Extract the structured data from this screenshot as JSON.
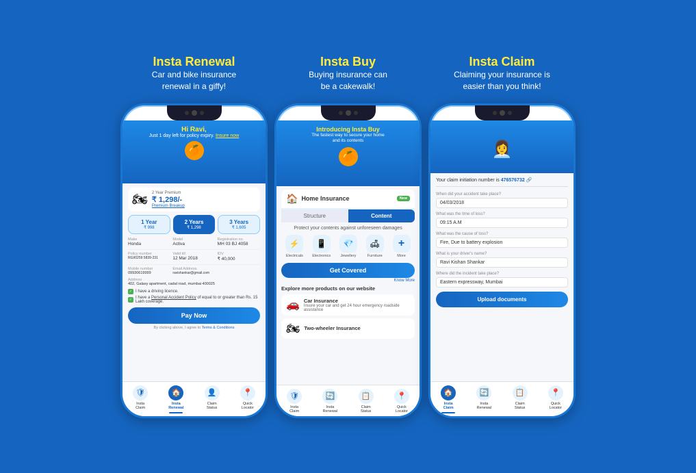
{
  "background_color": "#1565C0",
  "sections": [
    {
      "id": "insta_renewal",
      "title": "Insta Renewal",
      "subtitle": "Car and bike insurance\nrenewal in a giffy!",
      "screen": {
        "greeting": "Hi Ravi,",
        "greeting_sub": "Just 1 day left for policy expiry",
        "greeting_link": "Insure now",
        "premium_label": "2 Year Premium",
        "premium_amount": "₹ 1,298/-",
        "premium_link": "Premium Breakup",
        "year_tabs": [
          {
            "label": "1 Year",
            "price": "₹ 998",
            "active": false
          },
          {
            "label": "2 Years",
            "price": "₹ 1,298",
            "active": true
          },
          {
            "label": "3 Years",
            "price": "₹ 1,605",
            "active": false
          }
        ],
        "details": [
          {
            "label": "Make",
            "value": "Honda"
          },
          {
            "label": "Model",
            "value": "Activa"
          },
          {
            "label": "Registration no.",
            "value": "MH 03 BJ 4058"
          }
        ],
        "details2": [
          {
            "label": "Policy number",
            "value": "RGI/0259 5839-231"
          },
          {
            "label": "Valid till",
            "value": "12 Mar 2018"
          },
          {
            "label": "IDV",
            "value": "₹ 40,000"
          }
        ],
        "details3": [
          {
            "label": "Mobile number",
            "value": "09930619999"
          },
          {
            "label": "Email Address",
            "value": "ravishankar@gmail.com"
          }
        ],
        "address_label": "Address",
        "address_value": "402, Galaxy apartment, cadal road, mumbai 400025",
        "checkboxes": [
          {
            "text": "I have a driving licence.",
            "checked": true
          },
          {
            "text": "I have a Personal Accident Policy of equal to or greater than Rs. 15 Lakh coverage.",
            "checked": true
          }
        ],
        "pay_button": "Pay Now",
        "terms_text": "By clicking above, I agree to Terms & Conditions",
        "nav_items": [
          {
            "label": "Insta\nClaim",
            "active": false
          },
          {
            "label": "Insta\nRenewal",
            "active": true
          },
          {
            "label": "Claim\nStatus",
            "active": false
          },
          {
            "label": "Quick\nLocator",
            "active": false
          }
        ]
      }
    },
    {
      "id": "insta_buy",
      "title": "Insta Buy",
      "subtitle": "Buying insurance can\nbe a cakewalk!",
      "screen": {
        "greeting": "Introducing Insta Buy",
        "greeting_sub": "The fastest way to secure your home\nand its contents",
        "insurance_type": "Home Insurance",
        "new_badge": "New",
        "tabs": [
          {
            "label": "Structure",
            "active": false
          },
          {
            "label": "Content",
            "active": true
          }
        ],
        "protect_text": "Protect your contents against unforeseen damages",
        "icons": [
          {
            "icon": "⚡",
            "label": "Electricals"
          },
          {
            "icon": "📱",
            "label": "Electronics"
          },
          {
            "icon": "💎",
            "label": "Jewellery"
          },
          {
            "icon": "🪑",
            "label": "Furniture"
          },
          {
            "icon": "+",
            "label": "More"
          }
        ],
        "get_covered_btn": "Get Covered",
        "know_more": "Know More",
        "explore_title": "Explore more products on our website",
        "products": [
          {
            "icon": "🚗",
            "title": "Car Insurance",
            "desc": "Insure your car and get 24 hour emergency roadside assistance"
          },
          {
            "icon": "🏍",
            "title": "Two-wheeler Insurance",
            "desc": ""
          }
        ],
        "nav_items": [
          {
            "label": "Insta\nClaim",
            "active": false
          },
          {
            "label": "Insta\nRenewal",
            "active": false
          },
          {
            "label": "Claim\nStatus",
            "active": false
          },
          {
            "label": "Quick\nLocator",
            "active": false
          }
        ]
      }
    },
    {
      "id": "insta_claim",
      "title": "Insta Claim",
      "subtitle": "Claiming your insurance is\neasier than you think!",
      "screen": {
        "claim_number_text": "Your claim initiation number is",
        "claim_number": "476576732",
        "fields": [
          {
            "label": "When did your accident take place?",
            "value": "04/03/2018"
          },
          {
            "label": "What was the time of loss?",
            "value": "09:15 A.M"
          },
          {
            "label": "What was the cause of loss?",
            "value": "Fire, Due to battery explosion"
          },
          {
            "label": "What is your driver's name?",
            "value": "Ravi Kishan Shankar"
          },
          {
            "label": "Where did the incident take place?",
            "value": "Eastern expressway, Mumbai"
          }
        ],
        "upload_btn": "Upload documents",
        "nav_items": [
          {
            "label": "Insta\nClaim",
            "active": true
          },
          {
            "label": "Insta\nRenewal",
            "active": false
          },
          {
            "label": "Claim\nStatus",
            "active": false
          },
          {
            "label": "Quick\nLocator",
            "active": false
          }
        ]
      }
    }
  ]
}
